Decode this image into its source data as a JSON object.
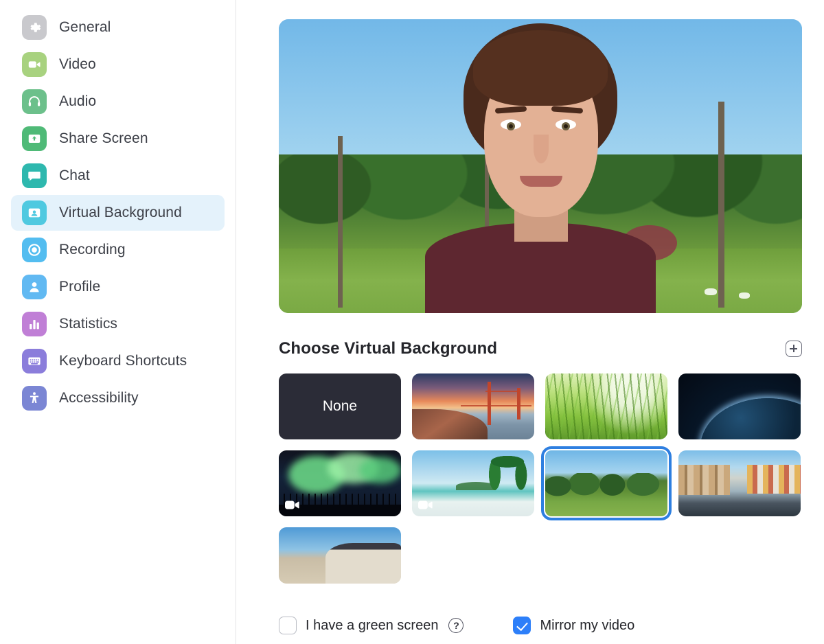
{
  "sidebar": {
    "items": [
      {
        "label": "General",
        "icon": "gear-icon",
        "color": "#c9c9cd",
        "active": false
      },
      {
        "label": "Video",
        "icon": "camcorder-icon",
        "color": "#a8d27f",
        "active": false
      },
      {
        "label": "Audio",
        "icon": "headphones-icon",
        "color": "#6cc08b",
        "active": false
      },
      {
        "label": "Share Screen",
        "icon": "share-screen-icon",
        "color": "#4fba77",
        "active": false
      },
      {
        "label": "Chat",
        "icon": "chat-bubble-icon",
        "color": "#2eb8ae",
        "active": false
      },
      {
        "label": "Virtual Background",
        "icon": "virtual-background-icon",
        "color": "#4fc9e0",
        "active": true
      },
      {
        "label": "Recording",
        "icon": "record-circle-icon",
        "color": "#53bdf0",
        "active": false
      },
      {
        "label": "Profile",
        "icon": "person-icon",
        "color": "#61b9f2",
        "active": false
      },
      {
        "label": "Statistics",
        "icon": "bar-chart-icon",
        "color": "#c07fd6",
        "active": false
      },
      {
        "label": "Keyboard Shortcuts",
        "icon": "keyboard-icon",
        "color": "#8b7ddb",
        "active": false
      },
      {
        "label": "Accessibility",
        "icon": "accessibility-icon",
        "color": "#7b86d4",
        "active": false
      }
    ]
  },
  "preview": {
    "alt": "self-view video preview with park virtual background"
  },
  "section": {
    "title": "Choose Virtual Background",
    "add_label": "+"
  },
  "backgrounds": [
    {
      "name": "None",
      "art": "none",
      "selected": false,
      "video": false,
      "clipped": false
    },
    {
      "name": "Golden Gate Bridge",
      "art": "bridge",
      "selected": false,
      "video": false,
      "clipped": false
    },
    {
      "name": "Grass",
      "art": "grass",
      "selected": false,
      "video": false,
      "clipped": false
    },
    {
      "name": "Earth From Space",
      "art": "earth",
      "selected": false,
      "video": false,
      "clipped": false
    },
    {
      "name": "Aurora Borealis",
      "art": "aurora",
      "selected": false,
      "video": true,
      "clipped": false
    },
    {
      "name": "Tropical Beach",
      "art": "beach",
      "selected": false,
      "video": true,
      "clipped": false
    },
    {
      "name": "Park Lawn",
      "art": "park",
      "selected": true,
      "video": false,
      "clipped": false
    },
    {
      "name": "Copenhagen Canal",
      "art": "canal",
      "selected": false,
      "video": false,
      "clipped": false
    },
    {
      "name": "City Plaza Building",
      "art": "plaza",
      "selected": false,
      "video": false,
      "clipped": true
    }
  ],
  "options": {
    "green_screen": {
      "label": "I have a green screen",
      "checked": false,
      "help": "?"
    },
    "mirror_video": {
      "label": "Mirror my video",
      "checked": true
    }
  },
  "colors": {
    "accent_blue": "#2d7ff9",
    "selection_ring": "#2e7fe0",
    "active_nav_bg": "#e4f2fb",
    "text": "#25262b"
  }
}
